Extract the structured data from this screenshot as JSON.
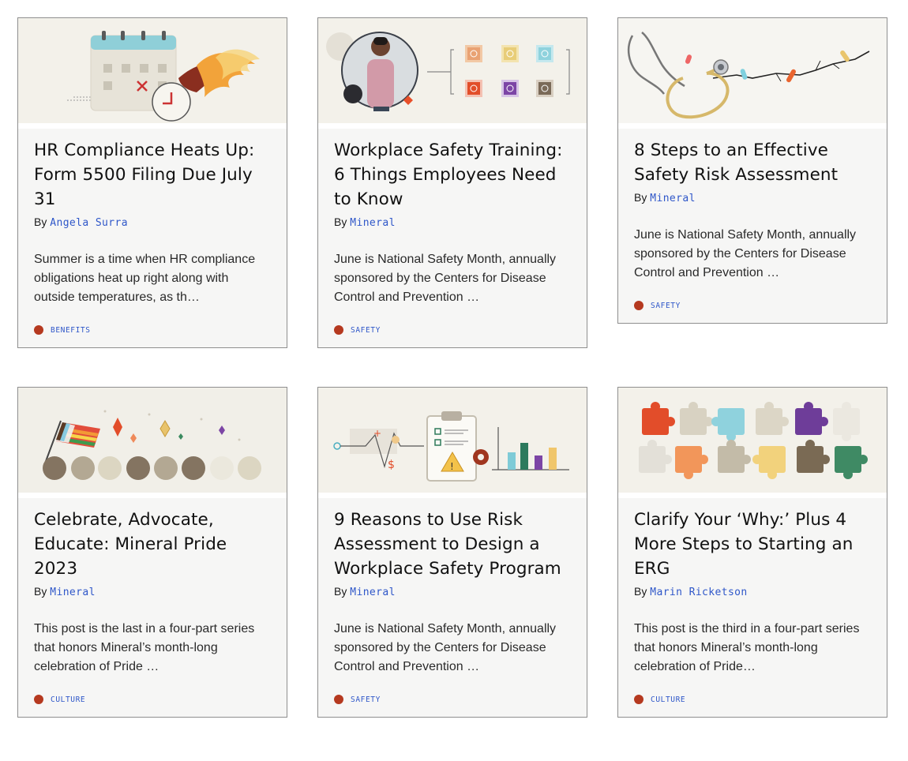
{
  "by_prefix": "By",
  "colors": {
    "tag_dot": "#b5391f",
    "link": "#2f57c9",
    "card_bg": "#f6f6f5",
    "border": "#8f8f8f"
  },
  "cards": [
    {
      "title": "HR Compliance Heats Up: Form 5500 Filing Due July 31",
      "author": "Angela Surra",
      "excerpt": "Summer is a time when HR compliance obligations heat up right along with outside temperatures, as th…",
      "tag": "BENEFITS",
      "image": "calendar-clock-flame-illustration"
    },
    {
      "title": "Workplace Safety Training: 6 Things Employees Need to Know",
      "author": "Mineral",
      "excerpt": "June is National Safety Month, annually sponsored by the Centers for Disease Control and Prevention …",
      "tag": "SAFETY",
      "image": "presenter-checklist-illustration"
    },
    {
      "title": "8 Steps to an Effective Safety Risk Assessment",
      "author": "Mineral",
      "excerpt": "June is National Safety Month, annually sponsored by the Centers for Disease Control and Prevention …",
      "tag": "SAFETY",
      "image": "stethoscope-crack-illustration"
    },
    {
      "title": "Celebrate, Advocate, Educate: Mineral Pride 2023",
      "author": "Mineral",
      "excerpt": "This post is the last in a four-part series that honors Mineral’s month-long celebration of Pride …",
      "tag": "CULTURE",
      "image": "pride-flag-sparkles-illustration"
    },
    {
      "title": "9 Reasons to Use Risk Assessment to Design a Workplace Safety Program",
      "author": "Mineral",
      "excerpt": "June is National Safety Month, annually sponsored by the Centers for Disease Control and Prevention …",
      "tag": "SAFETY",
      "image": "clipboard-chart-illustration"
    },
    {
      "title": "Clarify Your ‘Why:’ Plus 4 More Steps to Starting an ERG",
      "author": "Marin Ricketson",
      "excerpt": "This post is the third in a four-part series that honors Mineral’s month-long celebration of Pride…",
      "tag": "CULTURE",
      "image": "puzzle-pieces-illustration"
    }
  ]
}
